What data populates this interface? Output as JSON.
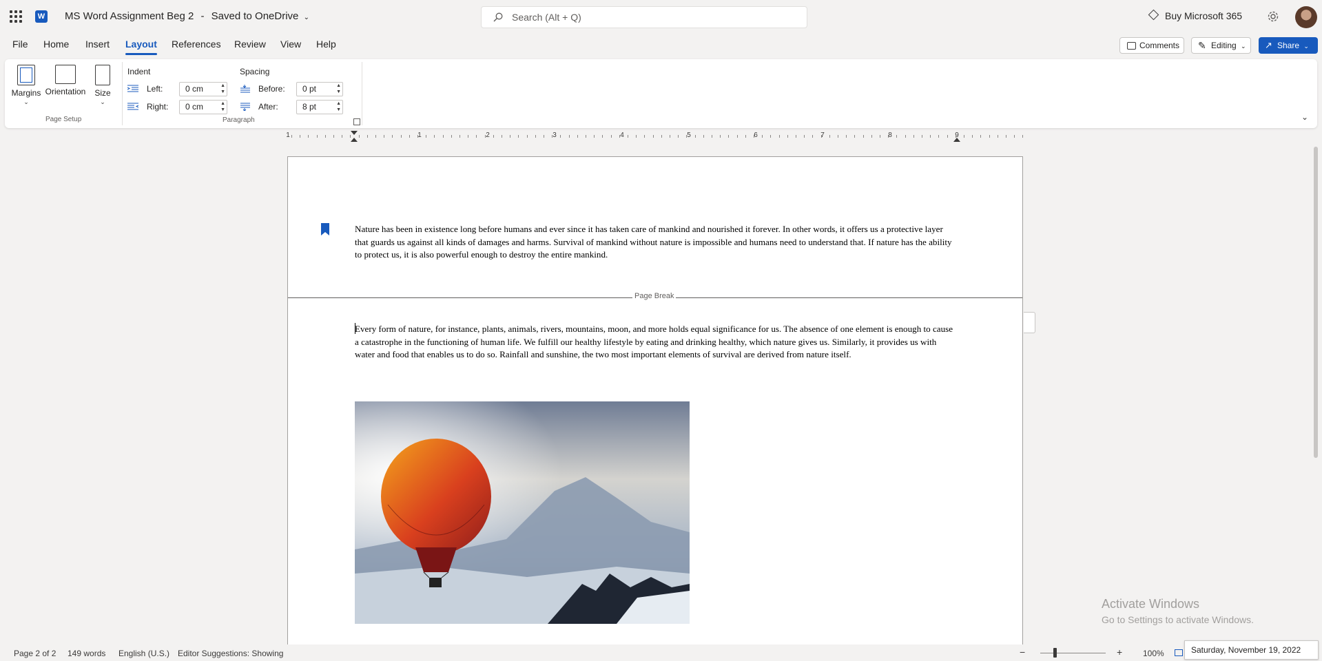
{
  "titlebar": {
    "app_icon_letter": "W",
    "doc_name": "MS Word Assignment Beg 2",
    "separator": "-",
    "save_status": "Saved to OneDrive",
    "search_placeholder": "Search (Alt + Q)",
    "buy_label": "Buy Microsoft 365"
  },
  "menu": {
    "tabs": [
      "File",
      "Home",
      "Insert",
      "Layout",
      "References",
      "Review",
      "View",
      "Help"
    ],
    "active_tab": "Layout",
    "comments_label": "Comments",
    "editing_label": "Editing",
    "share_label": "Share"
  },
  "ribbon": {
    "page_setup": {
      "group_label": "Page Setup",
      "margins_label": "Margins",
      "orientation_label": "Orientation",
      "size_label": "Size"
    },
    "paragraph": {
      "group_label": "Paragraph",
      "indent_label": "Indent",
      "spacing_label": "Spacing",
      "left_label": "Left:",
      "left_value": "0 cm",
      "right_label": "Right:",
      "right_value": "0 cm",
      "before_label": "Before:",
      "before_value": "0 pt",
      "after_label": "After:",
      "after_value": "8 pt"
    }
  },
  "ruler": {
    "numbers": [
      "1",
      "1",
      "2",
      "3",
      "4",
      "5",
      "6",
      "7",
      "8",
      "9"
    ]
  },
  "document": {
    "paragraph_1": "Nature has been in existence long before humans and ever since it has taken care of mankind and nourished it forever. In other words, it offers us a protective layer that guards us against all kinds of damages and harms. Survival of mankind without nature is impossible and humans need to understand that. If nature has the ability to protect us, it is also powerful enough to destroy the entire mankind.",
    "page_break_label": "Page Break",
    "paragraph_2": "Every form of nature, for instance, plants, animals, rivers, mountains, moon, and more holds equal significance for us. The absence of one element is enough to cause a catastrophe in the functioning of human life. We fulfill our healthy lifestyle by eating and drinking healthy, which nature gives us. Similarly, it provides us with water and food that enables us to do so. Rainfall and sunshine, the two most important elements of survival are derived from nature itself."
  },
  "watermark": {
    "line1": "Activate Windows",
    "line2": "Go to Settings to activate Windows."
  },
  "statusbar": {
    "page": "Page 2 of 2",
    "words": "149 words",
    "language": "English (U.S.)",
    "editor": "Editor Suggestions: Showing",
    "zoom": "100%",
    "date": "Saturday, November 19, 2022"
  },
  "colors": {
    "accent": "#185abd",
    "background": "#f3f2f1"
  }
}
